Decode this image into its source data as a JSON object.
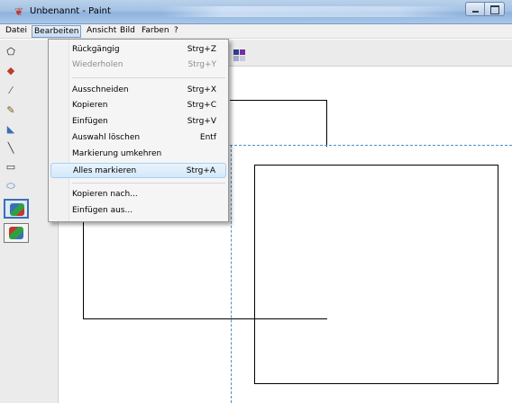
{
  "window": {
    "title": "Unbenannt - Paint"
  },
  "menubar": {
    "items": [
      "Datei",
      "Bearbeiten",
      "Ansicht",
      "Bild",
      "Farben",
      "?"
    ],
    "active": "Bearbeiten"
  },
  "edit_menu": {
    "items": [
      {
        "label": "Rückgängig",
        "shortcut": "Strg+Z",
        "disabled": false
      },
      {
        "label": "Wiederholen",
        "shortcut": "Strg+Y",
        "disabled": true
      },
      {
        "label": "Ausschneiden",
        "shortcut": "Strg+X",
        "disabled": false
      },
      {
        "label": "Kopieren",
        "shortcut": "Strg+C",
        "disabled": false
      },
      {
        "label": "Einfügen",
        "shortcut": "Strg+V",
        "disabled": false
      },
      {
        "label": "Auswahl löschen",
        "shortcut": "Entf",
        "disabled": false
      },
      {
        "label": "Markierung umkehren",
        "shortcut": "",
        "disabled": false
      },
      {
        "label": "Alles markieren",
        "shortcut": "Strg+A",
        "disabled": false,
        "highlighted": true
      },
      {
        "label": "Kopieren nach...",
        "shortcut": "",
        "disabled": false
      },
      {
        "label": "Einfügen aus...",
        "shortcut": "",
        "disabled": false
      }
    ]
  },
  "toolbox": {
    "tools": [
      "free-select",
      "select",
      "eraser",
      "fill",
      "color-picker",
      "magnifier",
      "pencil",
      "brush",
      "airbrush",
      "text",
      "line",
      "curve",
      "rectangle",
      "polygon",
      "ellipse",
      "rounded-rect"
    ],
    "options": [
      "transparent-off",
      "transparent-on"
    ]
  },
  "colors": {
    "palette_visible": [
      "#7030a0",
      "#2e3f8f",
      "#a8a8c8",
      "#c8c8e0"
    ],
    "selection_dash": "#4a90c8",
    "title_gradient": "#a4c2e4"
  }
}
